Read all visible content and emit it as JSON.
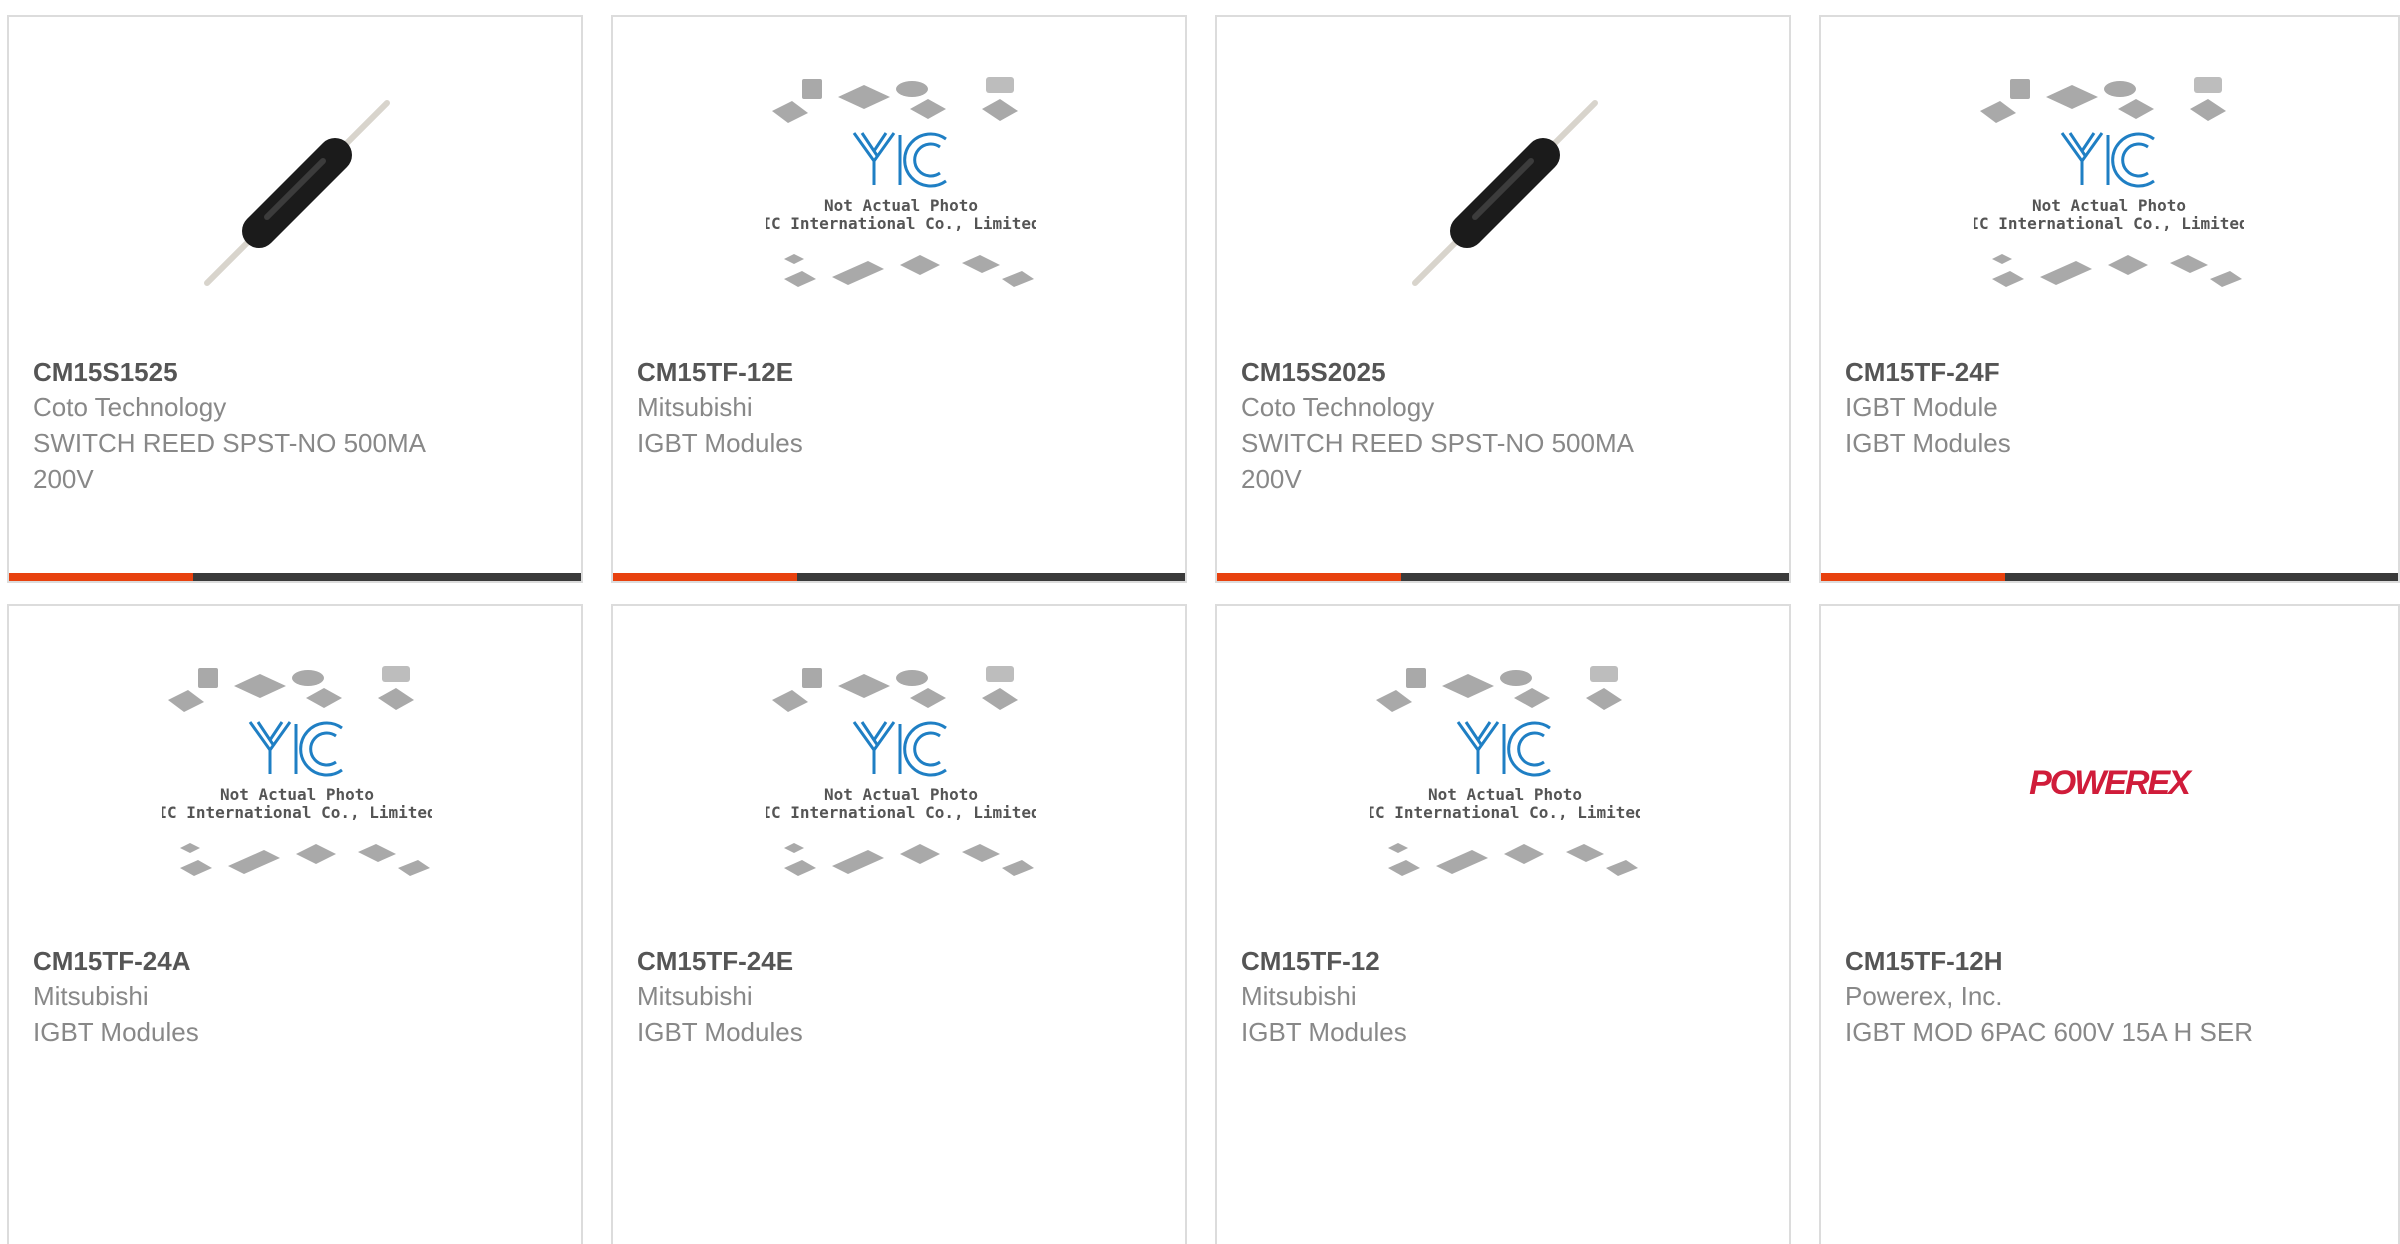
{
  "products": [
    {
      "part": "CM15S1525",
      "manufacturer": "Coto Technology",
      "description": "SWITCH REED SPST-NO 500MA 200V",
      "image": "reed-switch-photo"
    },
    {
      "part": "CM15TF-12E",
      "manufacturer": "Mitsubishi",
      "description": "IGBT Modules",
      "image": "placeholder-photo"
    },
    {
      "part": "CM15S2025",
      "manufacturer": "Coto Technology",
      "description": "SWITCH REED SPST-NO 500MA 200V",
      "image": "reed-switch-photo"
    },
    {
      "part": "CM15TF-24F",
      "manufacturer": "IGBT Module",
      "description": "IGBT Modules",
      "image": "placeholder-photo"
    },
    {
      "part": "CM15TF-24A",
      "manufacturer": "Mitsubishi",
      "description": "IGBT Modules",
      "image": "placeholder-photo"
    },
    {
      "part": "CM15TF-24E",
      "manufacturer": "Mitsubishi",
      "description": "IGBT Modules",
      "image": "placeholder-photo"
    },
    {
      "part": "CM15TF-12",
      "manufacturer": "Mitsubishi",
      "description": "IGBT Modules",
      "image": "placeholder-photo"
    },
    {
      "part": "CM15TF-12H",
      "manufacturer": "Powerex, Inc.",
      "description": "IGBT MOD 6PAC 600V 15A H SER",
      "image": "powerex-logo"
    }
  ],
  "placeholder": {
    "brand": "YIC",
    "line1": "Not Actual Photo",
    "line2": "YIC International Co., Limited."
  },
  "powerex_logo_text": "POWEREX",
  "colors": {
    "accent": "#e8410e",
    "bar": "#3a3a3a",
    "border": "#dcdcdc",
    "part_text": "#555555",
    "meta_text": "#888888",
    "yic_blue": "#1f7fc4",
    "powerex_red": "#d01c3a"
  }
}
